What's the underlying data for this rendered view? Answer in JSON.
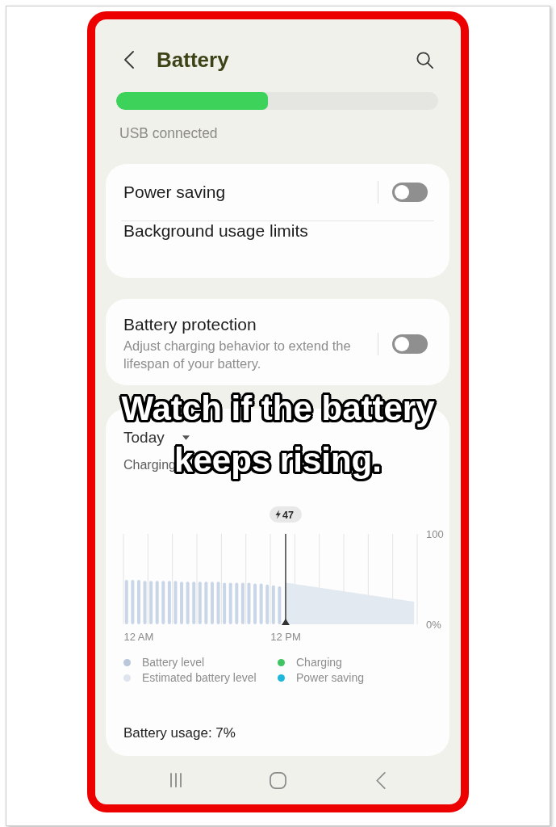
{
  "header": {
    "title": "Battery"
  },
  "battery_bar": {
    "level": 0.47
  },
  "status": "USB connected",
  "cards": [
    {
      "items": [
        {
          "kind": "toggle",
          "label": "Power saving",
          "on": false
        },
        {
          "kind": "link",
          "label": "Background usage limits"
        }
      ]
    },
    {
      "items": [
        {
          "kind": "toggle",
          "label": "Battery protection",
          "description": "Adjust charging behavior to extend the lifespan of your battery.",
          "on": false
        }
      ]
    }
  ],
  "usage_card": {
    "period": "Today",
    "state": "Charging",
    "chart_data": {
      "type": "bar",
      "categories": [
        null,
        null,
        "12 AM",
        null,
        null,
        null,
        null,
        null,
        null,
        null,
        null,
        null,
        null,
        null,
        null,
        null,
        null,
        null,
        null,
        null,
        null,
        null,
        null,
        null,
        null,
        null,
        "12 PM",
        null,
        null,
        null,
        null,
        null,
        null,
        null,
        null,
        null,
        null,
        null,
        null,
        null,
        null,
        null,
        null,
        null,
        null,
        null,
        null,
        null
      ],
      "series": [
        {
          "type": "bar",
          "color": "#c9d6e8",
          "values": [
            49,
            49,
            49,
            48,
            48,
            48,
            48,
            48,
            48,
            47,
            47,
            47,
            47,
            47,
            47,
            47,
            46,
            46,
            46,
            46,
            46,
            45,
            45,
            44,
            43,
            42,
            null,
            null,
            null,
            null,
            null,
            null,
            null,
            null,
            null,
            null,
            null,
            null,
            null,
            null,
            null,
            null,
            null,
            null,
            null,
            null,
            null,
            null
          ]
        },
        {
          "type": "area",
          "color": "#e3e9f1",
          "values": [
            null,
            null,
            null,
            null,
            null,
            null,
            null,
            null,
            null,
            null,
            null,
            null,
            null,
            null,
            null,
            null,
            null,
            null,
            null,
            null,
            null,
            null,
            null,
            null,
            null,
            null,
            46,
            45,
            44,
            43,
            42,
            41,
            40,
            39,
            38,
            37,
            36,
            35,
            34,
            33,
            32,
            31,
            30,
            29,
            28,
            27,
            26,
            25
          ]
        }
      ],
      "ylim": [
        0,
        100
      ],
      "yticks": [
        {
          "value": 100,
          "label": "100"
        },
        {
          "value": 0,
          "label": "0%"
        }
      ],
      "annotations": [
        "47"
      ]
    },
    "legend": [
      {
        "label": "Battery level",
        "color": "#b9c7da"
      },
      {
        "label": "Estimated battery level",
        "color": "#dfe5ee"
      },
      {
        "label": "Charging",
        "color": "#3fc462"
      },
      {
        "label": "Power saving",
        "color": "#1db7dc"
      }
    ],
    "usage": "Battery usage: 7%"
  },
  "caption": [
    "Watch if the battery",
    "keeps rising."
  ]
}
